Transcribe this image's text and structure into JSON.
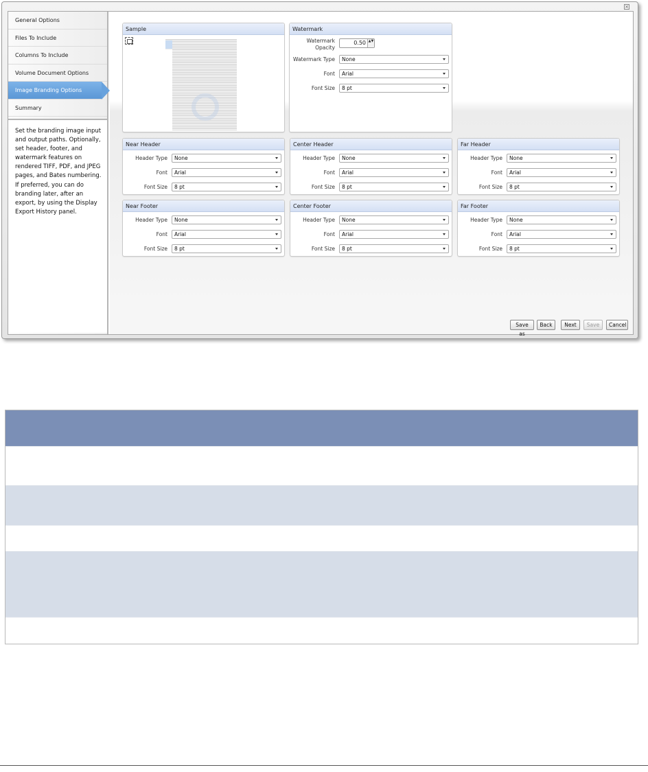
{
  "nav": {
    "items": [
      {
        "label": "General Options"
      },
      {
        "label": "Files To Include"
      },
      {
        "label": "Columns To Include"
      },
      {
        "label": "Volume Document Options"
      },
      {
        "label": "Image Branding Options"
      },
      {
        "label": "Summary"
      }
    ],
    "active_index": 4,
    "description": "Set the branding image input and output paths. Optionally, set header, footer, and watermark features on rendered TIFF, PDF, and JPEG pages, and Bates numbering. If preferred, you can do branding later, after an export, by using the Display Export History panel."
  },
  "sample": {
    "title": "Sample"
  },
  "watermark": {
    "title": "Watermark",
    "opacity_label": "Watermark Opacity",
    "opacity_value": "0.50",
    "type_label": "Watermark Type",
    "type_value": "None",
    "font_label": "Font",
    "font_value": "Arial",
    "size_label": "Font Size",
    "size_value": "8 pt"
  },
  "panels": [
    {
      "title": "Near Header",
      "type_label": "Header Type",
      "type_value": "None",
      "font_label": "Font",
      "font_value": "Arial",
      "size_label": "Font Size",
      "size_value": "8 pt"
    },
    {
      "title": "Center Header",
      "type_label": "Header Type",
      "type_value": "None",
      "font_label": "Font",
      "font_value": "Arial",
      "size_label": "Font Size",
      "size_value": "8 pt"
    },
    {
      "title": "Far Header",
      "type_label": "Header Type",
      "type_value": "None",
      "font_label": "Font",
      "font_value": "Arial",
      "size_label": "Font Size",
      "size_value": "8 pt"
    },
    {
      "title": "Near Footer",
      "type_label": "Header Type",
      "type_value": "None",
      "font_label": "Font",
      "font_value": "Arial",
      "size_label": "Font Size",
      "size_value": "8 pt"
    },
    {
      "title": "Center Footer",
      "type_label": "Header Type",
      "type_value": "None",
      "font_label": "Font",
      "font_value": "Arial",
      "size_label": "Font Size",
      "size_value": "8 pt"
    },
    {
      "title": "Far Footer",
      "type_label": "Header Type",
      "type_value": "None",
      "font_label": "Font",
      "font_value": "Arial",
      "size_label": "Font Size",
      "size_value": "8 pt"
    }
  ],
  "buttons": {
    "save_as": "Save as",
    "back": "Back",
    "next": "Next",
    "save": "Save",
    "cancel": "Cancel"
  },
  "close_glyph": "×",
  "spinner_glyph": "▲▼",
  "colors": {
    "active_nav": "#5b97d6",
    "panel_title_bg": "#d4e0f4",
    "table_header": "#7b8fb6",
    "table_alt_row": "#d6dde8"
  }
}
